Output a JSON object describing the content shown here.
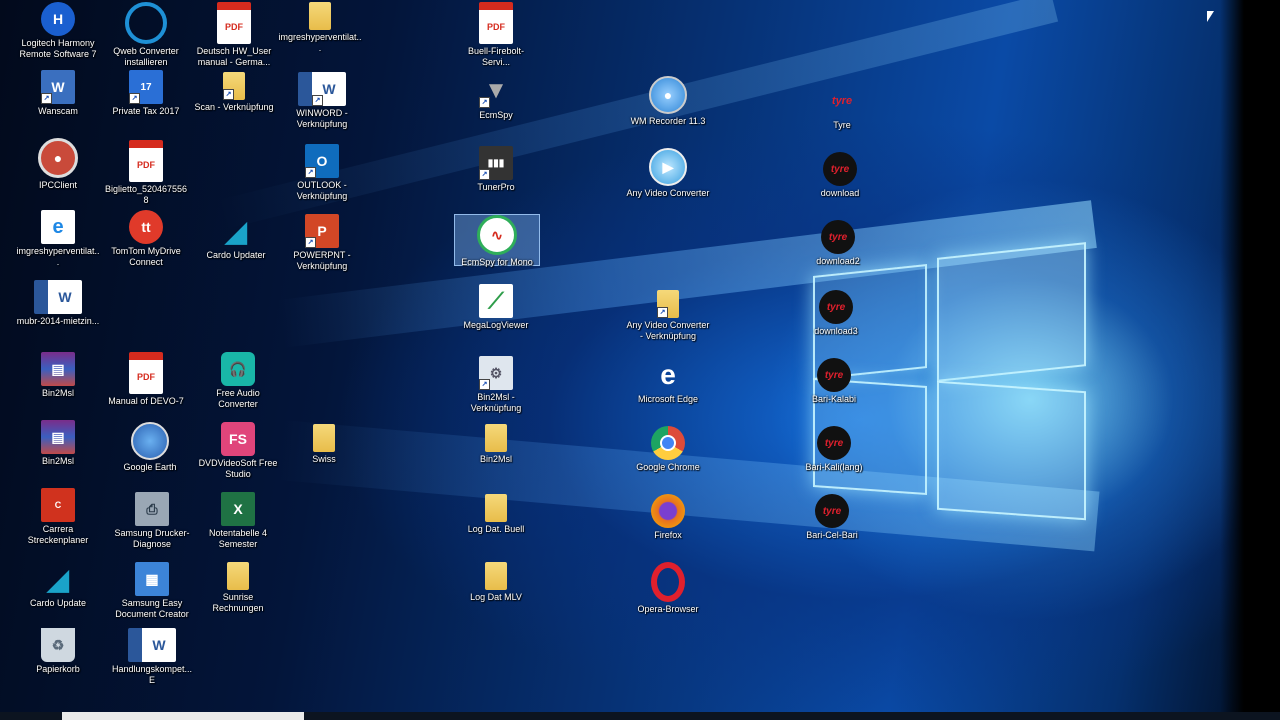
{
  "desktop": {
    "icons": [
      {
        "label": "Logitech Harmony Remote Software 7",
        "icon": "harmony-remote-icon",
        "color": "#1a5fd0"
      },
      {
        "label": "Wanscam",
        "icon": "wanscam-icon",
        "color": "#3a6fbf"
      },
      {
        "label": "IPCClient",
        "icon": "ipc-client-icon",
        "color": "#c94a3a"
      },
      {
        "label": "imgreshyperventilat...",
        "icon": "edge-document-icon",
        "color": "#1e88e5"
      },
      {
        "label": "mubr-2014-mietzin...",
        "icon": "word-document-icon",
        "color": "#2b579a"
      },
      {
        "label": "Bin2Msl",
        "icon": "winrar-archive-icon",
        "color": "#7a2d8a"
      },
      {
        "label": "Bin2Msl",
        "icon": "winrar-archive-icon",
        "color": "#7a2d8a"
      },
      {
        "label": "Carrera Streckenplaner",
        "icon": "carrera-icon",
        "color": "#d0321e"
      },
      {
        "label": "Cardo Update",
        "icon": "cardo-icon",
        "color": "#1aa3c9"
      },
      {
        "label": "Papierkorb",
        "icon": "recycle-bin-icon",
        "color": "#cfd8e0"
      },
      {
        "label": "Qweb Converter installieren",
        "icon": "qweb-icon",
        "color": "#1e90d6"
      },
      {
        "label": "Private Tax 2017",
        "icon": "private-tax-icon",
        "color": "#2a6fd6"
      },
      {
        "label": "Biglietto_5204675568",
        "icon": "pdf-icon",
        "color": "#d52b1e"
      },
      {
        "label": "TomTom MyDrive Connect",
        "icon": "tomtom-icon",
        "color": "#e03a2a"
      },
      {
        "label": "Manual of DEVO-7",
        "icon": "pdf-icon",
        "color": "#d52b1e"
      },
      {
        "label": "Google Earth",
        "icon": "google-earth-icon",
        "color": "#3b7dd8"
      },
      {
        "label": "Samsung Drucker-Diagnose",
        "icon": "printer-icon",
        "color": "#9aa7b5"
      },
      {
        "label": "Samsung Easy Document Creator",
        "icon": "document-creator-icon",
        "color": "#3c84d8"
      },
      {
        "label": "Handlungskompet... E",
        "icon": "word-document-icon",
        "color": "#2b579a"
      },
      {
        "label": "Deutsch HW_User manual - Germa...",
        "icon": "pdf-icon",
        "color": "#d52b1e"
      },
      {
        "label": "Scan - Verknüpfung",
        "icon": "folder-icon",
        "color": "#f0c75a"
      },
      {
        "label": "Cardo Updater",
        "icon": "cardo-icon",
        "color": "#1aa3c9"
      },
      {
        "label": "Free Audio Converter",
        "icon": "headphones-icon",
        "color": "#19b6a8"
      },
      {
        "label": "DVDVideoSoft Free Studio",
        "icon": "freestudio-icon",
        "color": "#e0457b"
      },
      {
        "label": "Notentabelle 4 Semester",
        "icon": "excel-icon",
        "color": "#1f7244"
      },
      {
        "label": "Sunrise Rechnungen",
        "icon": "folder-icon",
        "color": "#f0c75a"
      },
      {
        "label": "imgreshyperventilat...",
        "icon": "folder-icon",
        "color": "#f0c75a"
      },
      {
        "label": "WINWORD - Verknüpfung",
        "icon": "word-icon",
        "color": "#2b579a"
      },
      {
        "label": "OUTLOOK - Verknüpfung",
        "icon": "outlook-icon",
        "color": "#0f6cbd"
      },
      {
        "label": "POWERPNT - Verknüpfung",
        "icon": "powerpoint-icon",
        "color": "#d24726"
      },
      {
        "label": "Swiss",
        "icon": "folder-icon",
        "color": "#f0c75a"
      },
      {
        "label": "Buell-Firebolt-Servi...",
        "icon": "pdf-icon",
        "color": "#d52b1e"
      },
      {
        "label": "EcmSpy",
        "icon": "ecmspy-icon",
        "color": "#7a7a7a"
      },
      {
        "label": "TunerPro",
        "icon": "tunerpro-icon",
        "color": "#333333"
      },
      {
        "label": "EcmSpy for Mono",
        "icon": "ecmspy-mono-icon",
        "color": "#2fae5a"
      },
      {
        "label": "MegaLogViewer",
        "icon": "chart-icon",
        "color": "#2e9d4a"
      },
      {
        "label": "Bin2Msl - Verknüpfung",
        "icon": "shortcut-icon",
        "color": "#dfe6ee"
      },
      {
        "label": "Bin2Msl",
        "icon": "folder-icon",
        "color": "#f0c75a"
      },
      {
        "label": "Log Dat. Buell",
        "icon": "folder-icon",
        "color": "#f0c75a"
      },
      {
        "label": "Log Dat MLV",
        "icon": "folder-icon",
        "color": "#f0c75a"
      },
      {
        "label": "WM Recorder 11.3",
        "icon": "wm-recorder-icon",
        "color": "#2f86d6"
      },
      {
        "label": "Any Video Converter",
        "icon": "video-converter-icon",
        "color": "#3aa0e0"
      },
      {
        "label": "Any Video Converter - Verknüpfung",
        "icon": "folder-zip-icon",
        "color": "#f0c75a"
      },
      {
        "label": "Microsoft Edge",
        "icon": "edge-icon",
        "color": "#1e88e5"
      },
      {
        "label": "Google Chrome",
        "icon": "chrome-icon",
        "color": "#dd4b39"
      },
      {
        "label": "Firefox",
        "icon": "firefox-icon",
        "color": "#e8711f"
      },
      {
        "label": "Opera-Browser",
        "icon": "opera-icon",
        "color": "#e0202d"
      },
      {
        "label": "Tyre",
        "icon": "tyre-icon",
        "color": "#e0202d"
      },
      {
        "label": "download",
        "icon": "tyre-icon",
        "color": "#e0202d"
      },
      {
        "label": "download2",
        "icon": "tyre-icon",
        "color": "#e0202d"
      },
      {
        "label": "download3",
        "icon": "tyre-icon",
        "color": "#e0202d"
      },
      {
        "label": "Bari-Kalabi",
        "icon": "tyre-icon",
        "color": "#e0202d"
      },
      {
        "label": "Bari-Kali(lang)",
        "icon": "tyre-icon",
        "color": "#e0202d"
      },
      {
        "label": "Bari-Cel-Bari",
        "icon": "tyre-icon",
        "color": "#e0202d"
      }
    ],
    "selected_icon": "EcmSpy for Mono",
    "colors": {
      "accent": "#0a4aa6",
      "glow": "#8ce6ff",
      "label_text": "#ffffff"
    }
  }
}
